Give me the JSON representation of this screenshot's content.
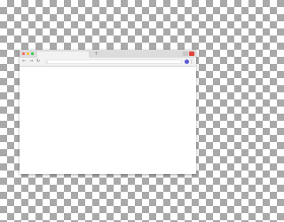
{
  "titlebar": {
    "traffic_lights": [
      {
        "name": "close",
        "color": "#ff5f56"
      },
      {
        "name": "minimize",
        "color": "#ffbd2e"
      },
      {
        "name": "maximize",
        "color": "#27c93f"
      }
    ],
    "tab_title": "",
    "new_tab_icon": "+",
    "close_color": "#e0443e"
  },
  "toolbar": {
    "back_icon": "←",
    "forward_icon": "→",
    "reload_icon": "↻",
    "search_icon": "⌕",
    "address_value": "",
    "profile_color": "#5b5bd6",
    "menu_icon": "⋮"
  },
  "colors": {
    "titlebar": "#dcdcdc",
    "toolbar": "#f2f2f2",
    "content": "#ffffff",
    "checker_dark": "#a9a9a9",
    "checker_light": "#ffffff"
  }
}
